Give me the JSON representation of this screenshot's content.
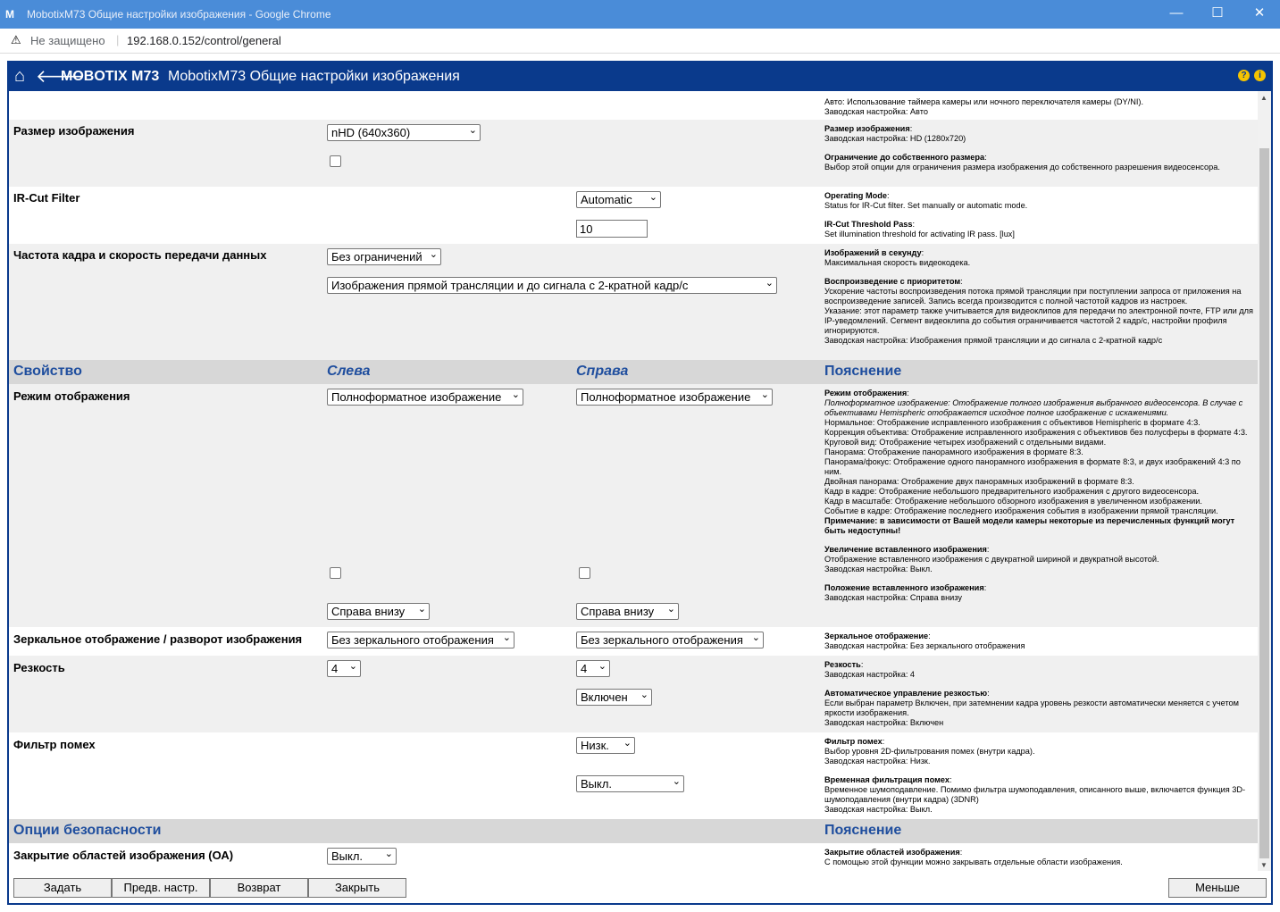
{
  "browser": {
    "window_title": "MobotixM73 Общие настройки изображения - Google Chrome",
    "not_secure": "Не защищено",
    "url": "192.168.0.152/control/general",
    "minimize": "—",
    "maximize": "☐",
    "close": "✕"
  },
  "header": {
    "brand": "MOBOTIX M73",
    "title": "MobotixM73 Общие настройки изображения",
    "help": "?",
    "info": "i"
  },
  "top_partial": {
    "line1": "Авто: Использование таймера камеры или ночного переключателя камеры (DY/NI).",
    "line2": "Заводская настройка: Авто"
  },
  "image_size": {
    "label": "Размер изображения",
    "value": "nHD (640x360)",
    "help_title": "Размер изображения",
    "help_default": "Заводская настройка: HD (1280x720)",
    "limit_title": "Ограничение до собственного размера",
    "limit_text": "Выбор этой опции для ограничения размера изображения до собственного разрешения видеосенсора."
  },
  "ircut": {
    "label": "IR-Cut Filter",
    "mode": "Automatic",
    "threshold": "10",
    "mode_title": "Operating Mode",
    "mode_text": "Status for IR-Cut filter. Set manually or automatic mode.",
    "thr_title": "IR-Cut Threshold Pass",
    "thr_text": "Set illumination threshold for activating IR pass. [lux]"
  },
  "framerate": {
    "label": "Частота кадра и скорость передачи данных",
    "fps": "Без ограничений",
    "priority": "Изображения прямой трансляции и до сигнала с 2-кратной кадр/с",
    "fps_title": "Изображений в секунду",
    "fps_text": "Максимальная скорость видеокодека.",
    "prio_title": "Воспроизведение с приоритетом",
    "prio_text1": "Ускорение частоты воспроизведения потока прямой трансляции при поступлении запроса от приложения на воспроизведение записей. Запись всегда производится с полной частотой кадров из настроек.",
    "prio_text2": "Указание: этот параметр также учитывается для видеоклипов для передачи по электронной почте, FTP или для IP-уведомлений. Сегмент видеоклипа до события ограничивается частотой 2 кадр/с, настройки профиля игнорируются.",
    "prio_default": "Заводская настройка: Изображения прямой трансляции и до сигнала с 2-кратной кадр/с"
  },
  "section1": {
    "property": "Свойство",
    "left": "Слева",
    "right": "Справа",
    "explanation": "Пояснение"
  },
  "display_mode": {
    "label": "Режим отображения",
    "left": "Полноформатное изображение",
    "right": "Полноформатное изображение",
    "title": "Режим отображения",
    "lines": [
      "Полноформатное изображение: Отображение полного изображения выбранного видеосенсора. В случае с объективами Hemispheric отображается исходное полное изображение с искажениями.",
      "Нормальное: Отображение исправленного изображения с объективов Hemispheric в формате 4:3.",
      "Коррекция объектива: Отображение исправленного изображения с объективов без полусферы в формате 4:3.",
      "Круговой вид: Отображение четырех изображений с отдельными видами.",
      "Панорама: Отображение панорамного изображения в формате 8:3.",
      "Панорама/фокус: Отображение одного панорамного изображения в формате 8:3, и двух изображений 4:3 по ним.",
      "Двойная панорама: Отображение двух панорамных изображений в формате 8:3.",
      "Кадр в кадре: Отображение небольшого предварительного изображения с другого видеосенсора.",
      "Кадр в масштабе: Отображение небольшого обзорного изображения в увеличенном изображении.",
      "Событие в кадре: Отображение последнего изображения события в изображении прямой трансляции."
    ],
    "note": "Примечание: в зависимости от Вашей модели камеры некоторые из перечисленных функций могут быть недоступны!",
    "enlarge_title": "Увеличение вставленного изображения",
    "enlarge_text": "Отображение вставленного изображения с двукратной шириной и двукратной высотой.",
    "enlarge_default": "Заводская настройка: Выкл.",
    "pos_left": "Справа внизу",
    "pos_right": "Справа внизу",
    "pos_title": "Положение вставленного изображения",
    "pos_default": "Заводская настройка: Справа внизу"
  },
  "mirror": {
    "label": "Зеркальное отображение / разворот изображения",
    "left": "Без зеркального отображения",
    "right": "Без зеркального отображения",
    "title": "Зеркальное отображение",
    "default": "Заводская настройка: Без зеркального отображения"
  },
  "sharpness": {
    "label": "Резкость",
    "left": "4",
    "right": "4",
    "auto": "Включен",
    "title": "Резкость",
    "default": "Заводская настройка: 4",
    "auto_title": "Автоматическое управление резкостью",
    "auto_text": "Если выбран параметр Включен, при затемнении кадра уровень резкости автоматически меняется с учетом яркости изображения.",
    "auto_default": "Заводская настройка: Включен"
  },
  "noise": {
    "label": "Фильтр помех",
    "filter": "Низк.",
    "temporal": "Выкл.",
    "title": "Фильтр помех",
    "text": "Выбор уровня 2D-фильтрования помех (внутри кадра).",
    "default": "Заводская настройка: Низк.",
    "temp_title": "Временная фильтрация помех",
    "temp_text": "Временное шумоподавление. Помимо фильтра шумоподавления, описанного выше, включается функция 3D-шумоподавления (внутри кадра) (3DNR)",
    "temp_default": "Заводская настройка: Выкл."
  },
  "section2": {
    "title": "Опции безопасности",
    "explanation": "Пояснение"
  },
  "masking": {
    "label": "Закрытие областей изображения (ОА)",
    "value": "Выкл.",
    "title": "Закрытие областей изображения",
    "text": "С помощью этой функции можно закрывать отдельные области изображения."
  },
  "buttons": {
    "set": "Задать",
    "preset": "Предв. настр.",
    "restore": "Возврат",
    "close": "Закрыть",
    "less": "Меньше"
  },
  "colors": {
    "header_bg": "#0a3a8c",
    "section_bg": "#d7d7d7",
    "section_text": "#1f4e9e",
    "titlebar": "#4a8cd8"
  }
}
